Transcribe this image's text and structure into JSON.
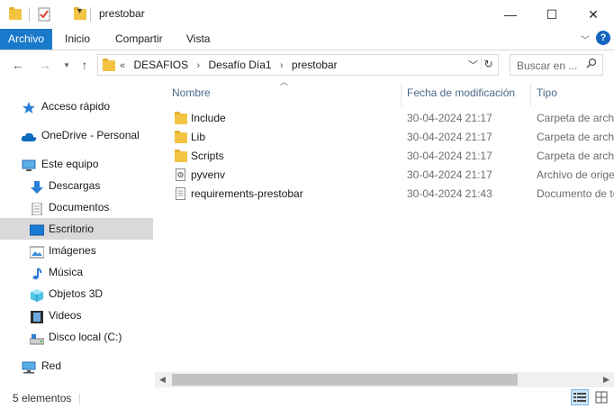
{
  "window": {
    "title": "prestobar",
    "minimize": "—",
    "maximize": "☐",
    "close": "✕"
  },
  "ribbon": {
    "tabs": [
      "Archivo",
      "Inicio",
      "Compartir",
      "Vista"
    ],
    "help": "?"
  },
  "address": {
    "overflow": "«",
    "crumbs": [
      "DESAFIOS",
      "Desafío Día1",
      "prestobar"
    ],
    "search_placeholder": "Buscar en ..."
  },
  "sidebar": {
    "items": [
      {
        "label": "Acceso rápido",
        "icon": "star-icon"
      },
      {
        "label": "OneDrive - Personal",
        "icon": "cloud-icon"
      },
      {
        "label": "Este equipo",
        "icon": "computer-icon"
      },
      {
        "label": "Descargas",
        "icon": "download-icon"
      },
      {
        "label": "Documentos",
        "icon": "documents-icon"
      },
      {
        "label": "Escritorio",
        "icon": "desktop-icon",
        "selected": true
      },
      {
        "label": "Imágenes",
        "icon": "pictures-icon"
      },
      {
        "label": "Música",
        "icon": "music-icon"
      },
      {
        "label": "Objetos 3D",
        "icon": "3d-objects-icon"
      },
      {
        "label": "Videos",
        "icon": "videos-icon"
      },
      {
        "label": "Disco local (C:)",
        "icon": "drive-icon"
      },
      {
        "label": "Red",
        "icon": "network-icon"
      }
    ]
  },
  "columns": {
    "name": "Nombre",
    "date": "Fecha de modificación",
    "type": "Tipo"
  },
  "files": [
    {
      "name": "Include",
      "date": "30-04-2024 21:17",
      "type": "Carpeta de archivos",
      "icon": "folder-icon"
    },
    {
      "name": "Lib",
      "date": "30-04-2024 21:17",
      "type": "Carpeta de archivos",
      "icon": "folder-icon"
    },
    {
      "name": "Scripts",
      "date": "30-04-2024 21:17",
      "type": "Carpeta de archivos",
      "icon": "folder-icon"
    },
    {
      "name": "pyvenv",
      "date": "30-04-2024 21:17",
      "type": "Archivo de origen",
      "icon": "config-file-icon"
    },
    {
      "name": "requirements-prestobar",
      "date": "30-04-2024 21:43",
      "type": "Documento de texto",
      "icon": "text-file-icon"
    }
  ],
  "status": {
    "count": "5 elementos"
  },
  "colors": {
    "accent": "#1979ca",
    "selected_bg": "#d9d9d9",
    "folder": "#f3c442"
  }
}
